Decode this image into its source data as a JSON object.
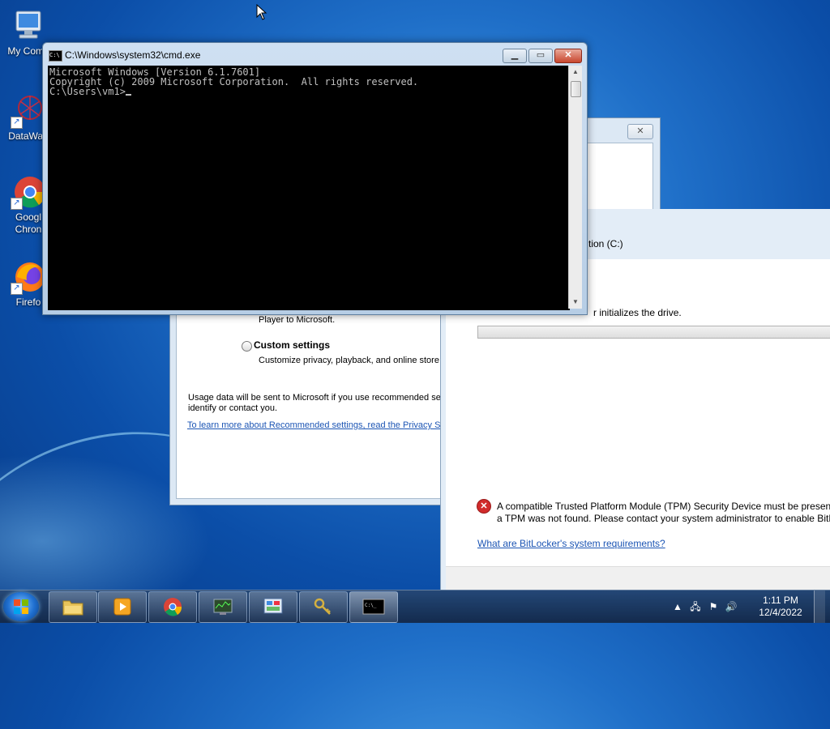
{
  "desktop": {
    "icons": [
      {
        "label": "My Comp"
      },
      {
        "label": "DataWag"
      },
      {
        "label_line1": "Googl",
        "label_line2": "Chron"
      },
      {
        "label": "Firefo"
      }
    ]
  },
  "cmd": {
    "title": "C:\\Windows\\system32\\cmd.exe",
    "lines": [
      "Microsoft Windows [Version 6.1.7601]",
      "Copyright (c) 2009 Microsoft Corporation.  All rights reserved.",
      "",
      "C:\\Users\\vm1>"
    ]
  },
  "wmp_setup": {
    "recommended_desc_tail": "Player to Microsoft.",
    "custom_label": "Custom settings",
    "custom_desc": "Customize privacy, playback, and online store",
    "usage_line1": "Usage data will be sent to Microsoft if you use recommended set",
    "usage_line2": "identify or contact you.",
    "privacy_link": "To learn more about Recommended settings, read the Privacy Sta"
  },
  "bitlocker": {
    "drive_label": "tion (C:)",
    "initializing_text": "r initializes the drive.",
    "tpm_error_line1": "A compatible Trusted Platform Module (TPM) Security Device must be present",
    "tpm_error_line2": "a TPM was not found. Please contact your system administrator to enable BitL",
    "requirements_link": "What are BitLocker's system requirements?"
  },
  "taskbar": {
    "buttons": [
      "windows-explorer",
      "windows-media-player",
      "google-chrome",
      "network-monitor",
      "control-panel",
      "key-manager",
      "command-prompt"
    ],
    "clock_time": "1:11 PM",
    "clock_date": "12/4/2022"
  }
}
